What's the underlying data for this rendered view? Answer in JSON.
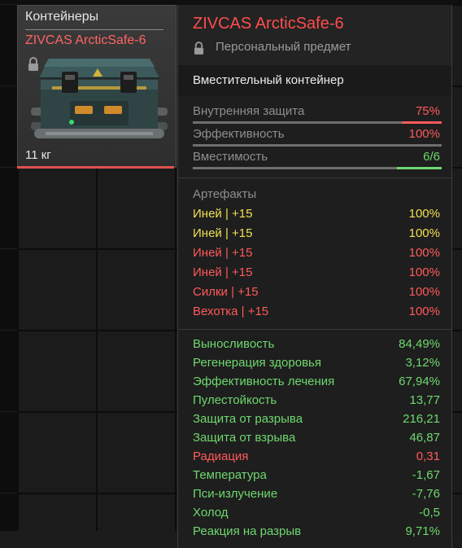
{
  "colors": {
    "red": "#ff5a5a",
    "yellow": "#f0e050",
    "green": "#6ed86e",
    "grey": "#8e8e8e"
  },
  "slot": {
    "category": "Контейнеры",
    "name": "ZIVCAS ArcticSafe-6",
    "weight": "11 кг",
    "lock_icon": "lock-icon"
  },
  "tooltip": {
    "title": "ZIVCAS ArcticSafe-6",
    "personal": "Персональный предмет",
    "type": "Вместительный контейнер",
    "stats": [
      {
        "label": "Внутренняя защита",
        "value": "75%",
        "fill": 0.16,
        "color": "red"
      },
      {
        "label": "Эффективность",
        "value": "100%",
        "fill": 0.0,
        "color": "red"
      },
      {
        "label": "Вместимость",
        "value": "6/6",
        "fill": 0.18,
        "color": "green"
      }
    ],
    "artifacts_title": "Артефакты",
    "artifacts": [
      {
        "name": "Иней | +15",
        "pct": "100%",
        "color": "yellow"
      },
      {
        "name": "Иней | +15",
        "pct": "100%",
        "color": "yellow"
      },
      {
        "name": "Иней | +15",
        "pct": "100%",
        "color": "red"
      },
      {
        "name": "Иней | +15",
        "pct": "100%",
        "color": "red"
      },
      {
        "name": "Силки | +15",
        "pct": "100%",
        "color": "red"
      },
      {
        "name": "Вехотка | +15",
        "pct": "100%",
        "color": "red"
      }
    ],
    "effects": [
      {
        "name": "Выносливость",
        "value": "84,49%",
        "color": "green"
      },
      {
        "name": "Регенерация здоровья",
        "value": "3,12%",
        "color": "green"
      },
      {
        "name": "Эффективность лечения",
        "value": "67,94%",
        "color": "green"
      },
      {
        "name": "Пулестойкость",
        "value": "13,77",
        "color": "green"
      },
      {
        "name": "Защита от разрыва",
        "value": "216,21",
        "color": "green"
      },
      {
        "name": "Защита от взрыва",
        "value": "46,87",
        "color": "green"
      },
      {
        "name": "Радиация",
        "value": "0,31",
        "color": "red"
      },
      {
        "name": "Температура",
        "value": "-1,67",
        "color": "green"
      },
      {
        "name": "Пси-излучение",
        "value": "-7,76",
        "color": "green"
      },
      {
        "name": "Холод",
        "value": "-0,5",
        "color": "green"
      },
      {
        "name": "Реакция на разрыв",
        "value": "9,71%",
        "color": "green"
      }
    ]
  }
}
